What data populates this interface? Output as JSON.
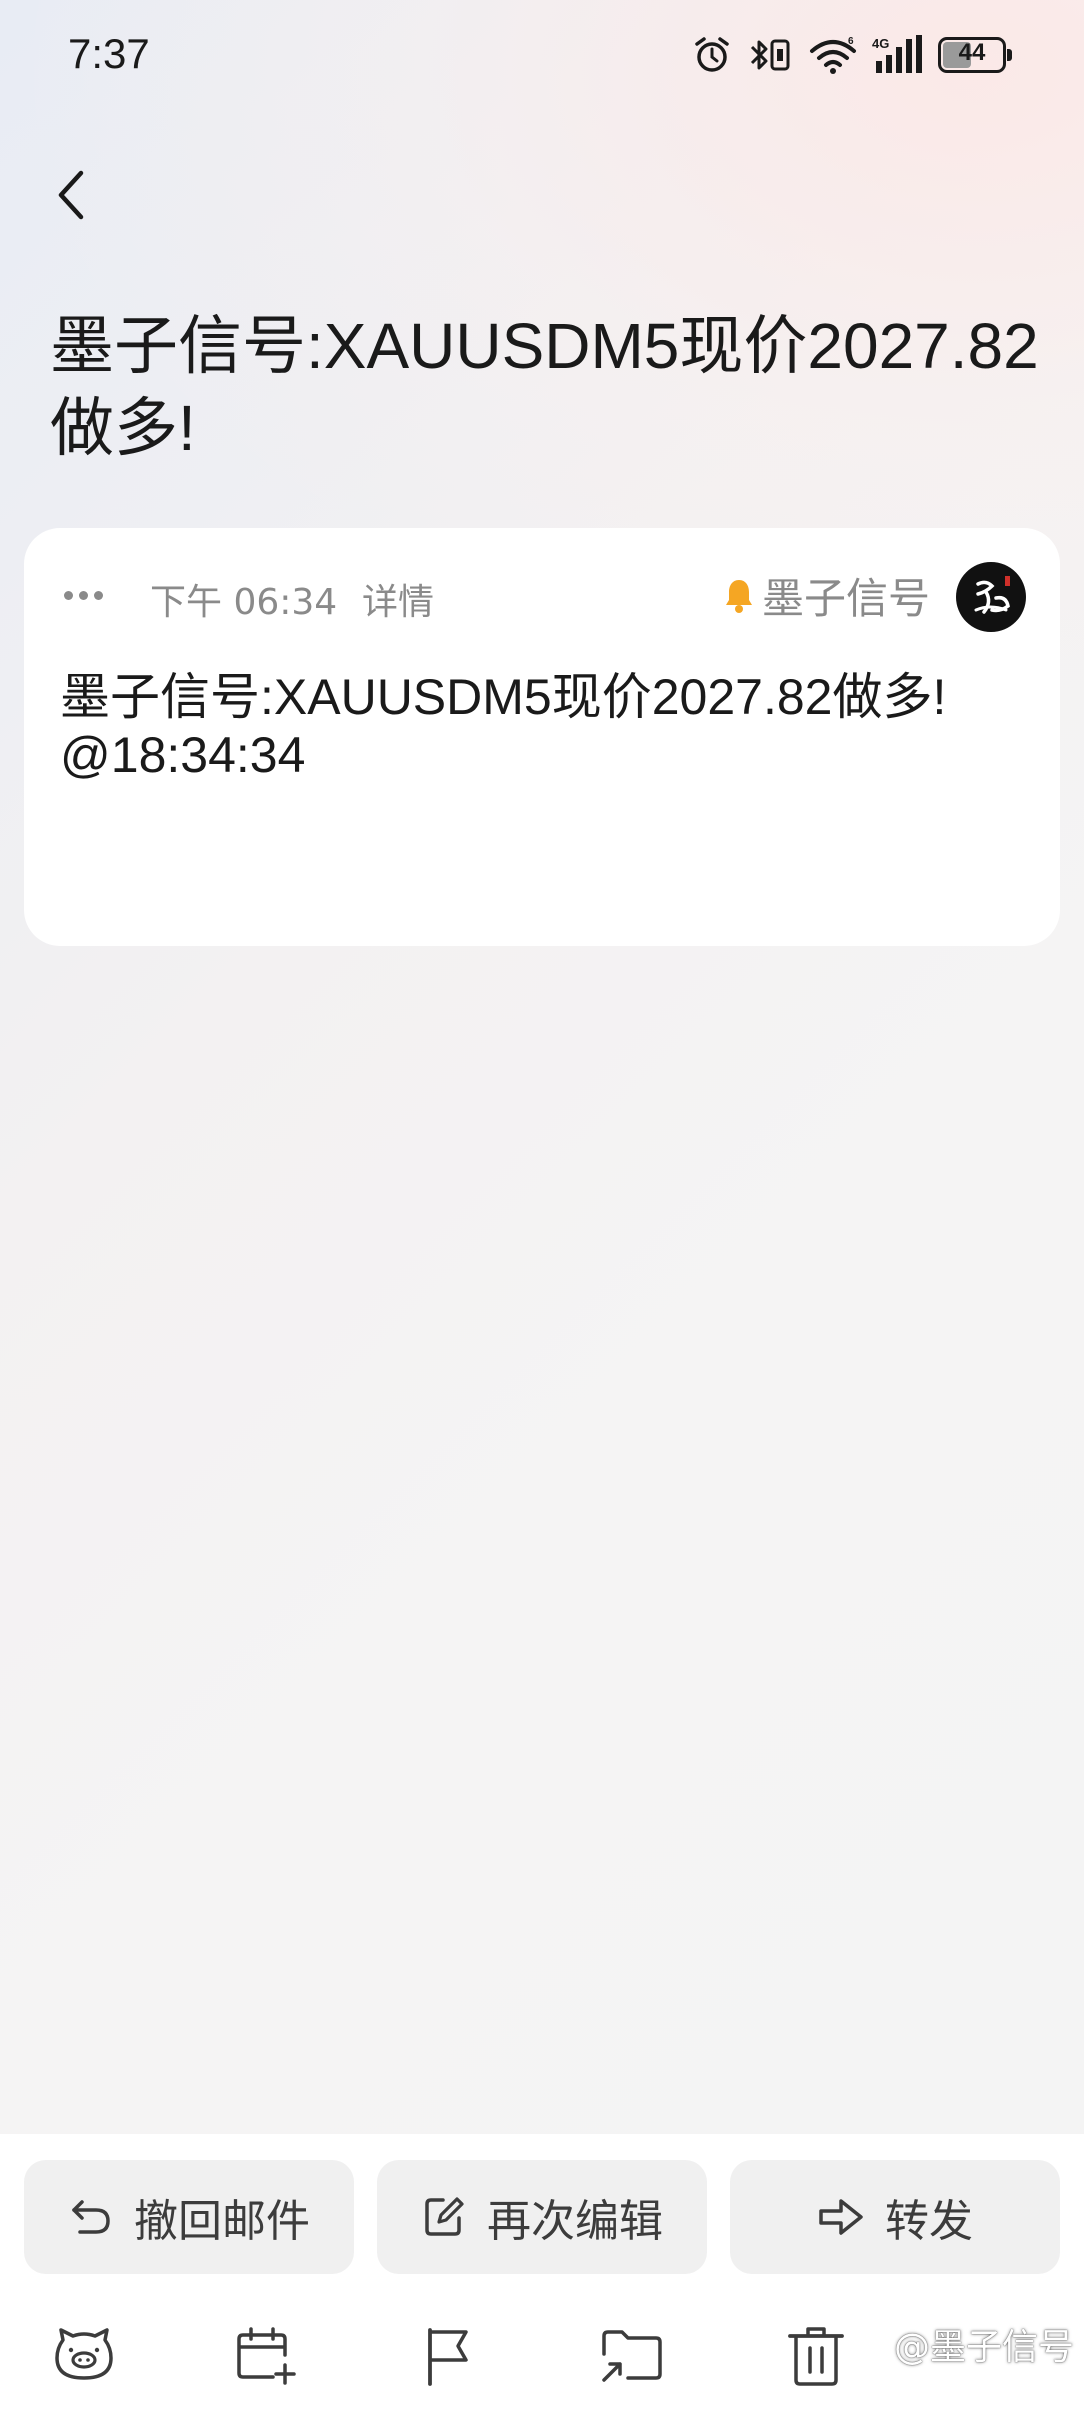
{
  "status_bar": {
    "time": "7:37",
    "network": "4G",
    "battery": "44"
  },
  "page": {
    "title": "墨子信号:XAUUSDM5现价2027.82做多!"
  },
  "card": {
    "time": "下午 06:34",
    "detail_label": "详情",
    "sender": "墨子信号",
    "body_line1": "墨子信号:XAUUSDM5现价2027.82做多!",
    "body_line2": "@18:34:34"
  },
  "actions": {
    "recall": "撤回邮件",
    "reedit": "再次编辑",
    "forward": "转发"
  },
  "toolbar": {
    "icons": [
      "pig-icon",
      "add-calendar-icon",
      "flag-icon",
      "move-folder-icon",
      "trash-icon"
    ]
  },
  "watermark": {
    "text": "@墨子信号"
  },
  "colors": {
    "accent_bell": "#f5a623",
    "secondary_text": "#8a8a8a",
    "button_bg": "#f0f0f0"
  }
}
